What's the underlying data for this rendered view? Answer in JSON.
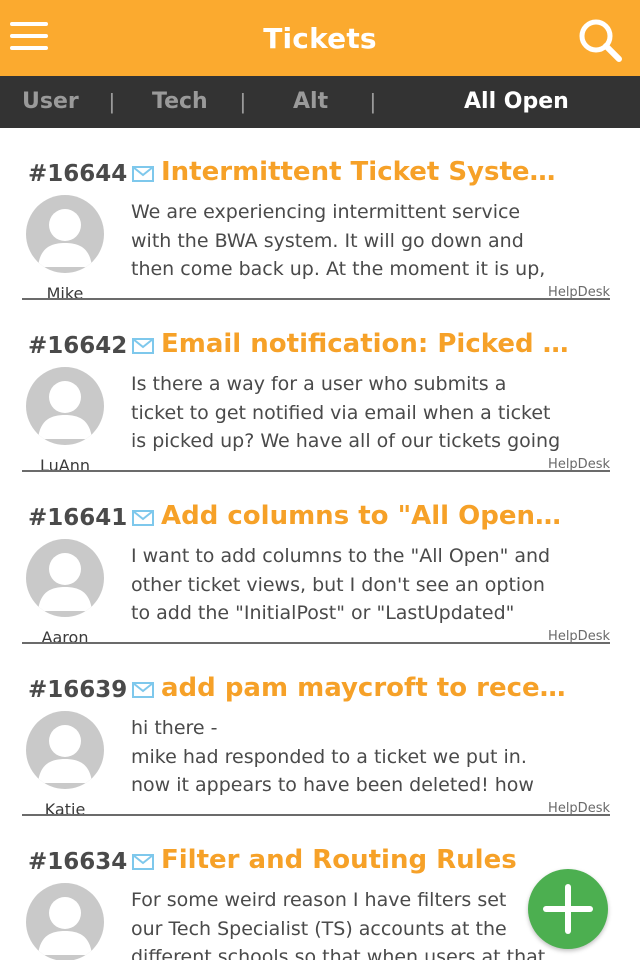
{
  "header": {
    "title": "Tickets",
    "menu_icon": "hamburger-menu-icon",
    "search_icon": "search-icon",
    "background": "#fbaa2f"
  },
  "tabs": [
    {
      "label": "User",
      "active": false
    },
    {
      "label": "Tech",
      "active": false
    },
    {
      "label": "Alt",
      "active": false
    },
    {
      "label": "All Open",
      "active": true
    }
  ],
  "tab_separator": "|",
  "tickets": [
    {
      "number": "#16644",
      "subject": "Intermittent Ticket System S...",
      "preview": "We are experiencing intermittent service\nwith the BWA system. It will go down and\nthen come back up. At the moment it is up,",
      "user": "Mike",
      "source": "HelpDesk"
    },
    {
      "number": "#16642",
      "subject": "Email notification: Picked Up ...",
      "preview": "Is there a way for a user who submits a\nticket to get notified via email when a ticket\nis picked up? We have all of our tickets going",
      "user": "LuAnn",
      "source": "HelpDesk"
    },
    {
      "number": "#16641",
      "subject": "Add columns to \"All Open\" a...",
      "preview": "I want to add columns to the \"All Open\" and\nother ticket views, but I don't see an option\nto add the \"InitialPost\" or \"LastUpdated\"",
      "user": "Aaron",
      "source": "HelpDesk"
    },
    {
      "number": "#16639",
      "subject": "add pam maycroft to receive ...",
      "preview": "hi there -\nmike had responded to a ticket we put in.\nnow it appears to have been deleted! how",
      "user": "Katie",
      "source": "HelpDesk"
    },
    {
      "number": "#16634",
      "subject": "Filter and Routing Rules",
      "preview": "For some weird reason I have filters set\nour Tech Specialist (TS) accounts at the\ndifferent schools so that when users at that",
      "user": "",
      "source": ""
    }
  ],
  "fab": {
    "icon": "plus-icon",
    "color": "#4caf50"
  },
  "colors": {
    "accent": "#f6a128",
    "tabbar": "#333333",
    "avatar": "#c9c9c9"
  }
}
